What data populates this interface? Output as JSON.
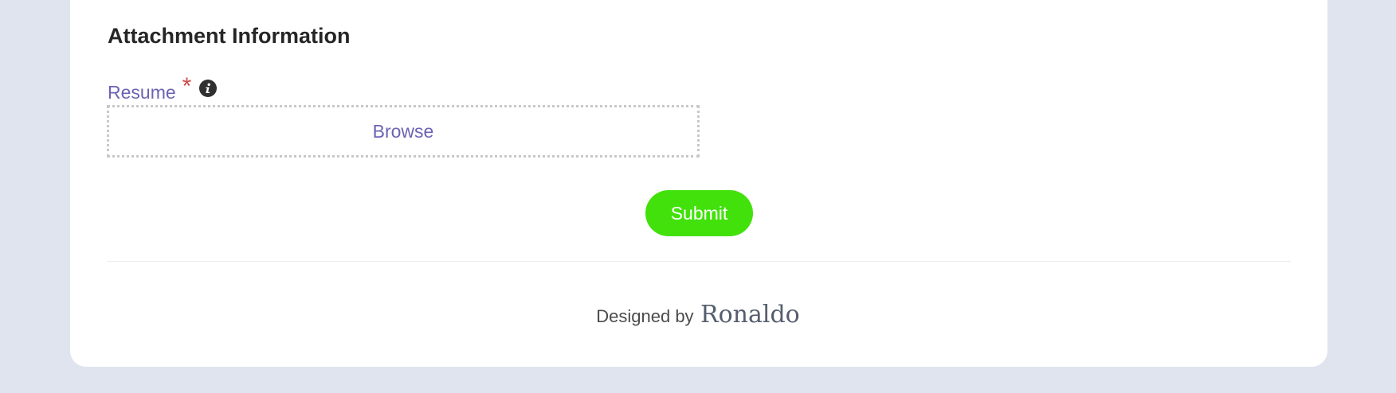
{
  "section": {
    "title": "Attachment Information"
  },
  "resume_field": {
    "label": "Resume",
    "required_marker": "*",
    "info_icon": "info-icon",
    "browse_label": "Browse"
  },
  "actions": {
    "submit_label": "Submit"
  },
  "footer": {
    "prefix": "Designed by",
    "designer": "Ronaldo"
  },
  "colors": {
    "page_background": "#dfe4ef",
    "card_background": "#ffffff",
    "label": "#6b63b4",
    "required": "#cf4b4b",
    "submit": "#42e10c"
  }
}
